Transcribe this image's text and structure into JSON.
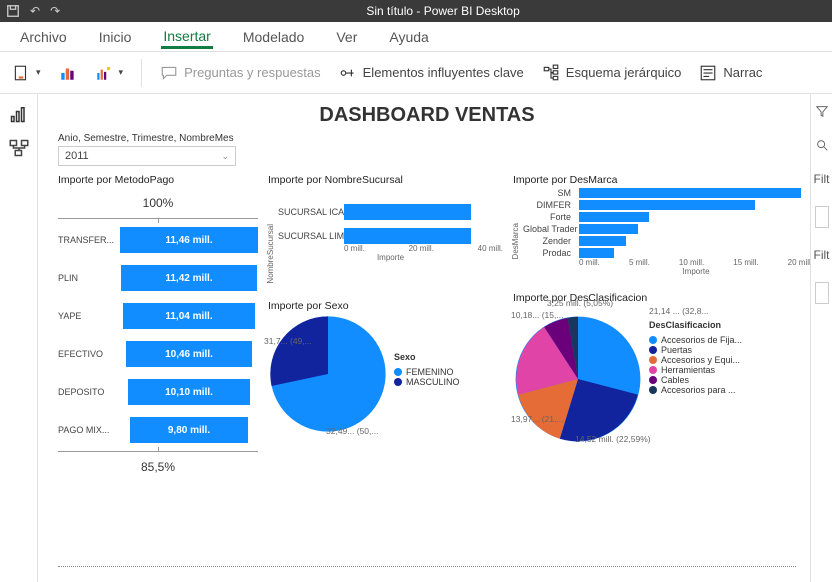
{
  "app": {
    "title": "Sin título - Power BI Desktop"
  },
  "menubar": {
    "archivo": "Archivo",
    "inicio": "Inicio",
    "insertar": "Insertar",
    "modelado": "Modelado",
    "ver": "Ver",
    "ayuda": "Ayuda"
  },
  "ribbon": {
    "preguntas": "Preguntas y respuestas",
    "influyentes": "Elementos influyentes clave",
    "esquema": "Esquema jerárquico",
    "narrac": "Narrac"
  },
  "rightrail": {
    "filt1": "Filt",
    "filt2": "Filt"
  },
  "dashboard": {
    "title": "DASHBOARD VENTAS"
  },
  "slicer": {
    "label": "Anio, Semestre, Trimestre, NombreMes",
    "value": "2011"
  },
  "funnel": {
    "title": "Importe por MetodoPago",
    "top": "100%",
    "rows": [
      {
        "cat": "TRANSFER...",
        "val": "11,46 mill.",
        "pct": 100
      },
      {
        "cat": "PLIN",
        "val": "11,42 mill.",
        "pct": 99
      },
      {
        "cat": "YAPE",
        "val": "11,04 mill.",
        "pct": 96
      },
      {
        "cat": "EFECTIVO",
        "val": "10,46 mill.",
        "pct": 91
      },
      {
        "cat": "DEPOSITO",
        "val": "10,10 mill.",
        "pct": 88
      },
      {
        "cat": "PAGO MIX...",
        "val": "9,80 mill.",
        "pct": 86
      }
    ],
    "bottom": "85,5%"
  },
  "sucursal": {
    "title": "Importe por NombreSucursal",
    "ylabel": "NombreSucursal",
    "xlabel": "Importe",
    "ticks": [
      "0 mill.",
      "20 mill.",
      "40 mill."
    ],
    "rows": [
      {
        "cat": "SUCURSAL ICA",
        "val": 32
      },
      {
        "cat": "SUCURSAL LIMA",
        "val": 32
      }
    ]
  },
  "marca": {
    "title": "Importe por DesMarca",
    "ylabel": "DesMarca",
    "xlabel": "Importe",
    "ticks": [
      "0 mill.",
      "5 mill.",
      "10 mill.",
      "15 mill.",
      "20 mill."
    ],
    "rows": [
      {
        "cat": "SM",
        "val": 19
      },
      {
        "cat": "DIMFER",
        "val": 15
      },
      {
        "cat": "Forte",
        "val": 6
      },
      {
        "cat": "Global Trader",
        "val": 5
      },
      {
        "cat": "Zender",
        "val": 4
      },
      {
        "cat": "Prodac",
        "val": 3
      }
    ]
  },
  "sexo": {
    "title": "Importe por Sexo",
    "legend_title": "Sexo",
    "labels_around": {
      "left": "31,7... (49,...",
      "bottom": "32,49... (50,..."
    },
    "legend": [
      {
        "name": "FEMENINO",
        "color": "#118dff"
      },
      {
        "name": "MASCULINO",
        "color": "#12239e"
      }
    ]
  },
  "clasif": {
    "title": "Importe por DesClasificacion",
    "legend_title": "DesClasificacion",
    "labels_around": {
      "top1": "3,25 mill. (5,05%)",
      "top2": "10,18... (15,...",
      "right": "21,14 ... (32,8...",
      "bottom": "14,52 mill. (22,59%)",
      "left": "13,97... (21,..."
    },
    "legend": [
      {
        "name": "Accesorios de Fija...",
        "color": "#118dff"
      },
      {
        "name": "Puertas",
        "color": "#12239e"
      },
      {
        "name": "Accesorios y Equi...",
        "color": "#e66c37"
      },
      {
        "name": "Herramientas",
        "color": "#e044a7"
      },
      {
        "name": "Cables",
        "color": "#6b007b"
      },
      {
        "name": "Accesorios para ...",
        "color": "#1a365d"
      }
    ]
  },
  "chart_data": [
    {
      "type": "bar",
      "orientation": "funnel",
      "title": "Importe por MetodoPago",
      "categories": [
        "TRANSFERENCIA",
        "PLIN",
        "YAPE",
        "EFECTIVO",
        "DEPOSITO",
        "PAGO MIXTO"
      ],
      "values": [
        11.46,
        11.42,
        11.04,
        10.46,
        10.1,
        9.8
      ],
      "unit": "mill.",
      "top_pct": 100,
      "bottom_pct": 85.5
    },
    {
      "type": "bar",
      "orientation": "horizontal",
      "title": "Importe por NombreSucursal",
      "categories": [
        "SUCURSAL ICA",
        "SUCURSAL LIMA"
      ],
      "values": [
        32,
        32
      ],
      "xlabel": "Importe",
      "ylabel": "NombreSucursal",
      "xlim": [
        0,
        40
      ],
      "unit": "mill."
    },
    {
      "type": "bar",
      "orientation": "horizontal",
      "title": "Importe por DesMarca",
      "categories": [
        "SM",
        "DIMFER",
        "Forte",
        "Global Trader",
        "Zender",
        "Prodac"
      ],
      "values": [
        19,
        15,
        6,
        5,
        4,
        3
      ],
      "xlabel": "Importe",
      "ylabel": "DesMarca",
      "xlim": [
        0,
        20
      ],
      "unit": "mill."
    },
    {
      "type": "pie",
      "title": "Importe por Sexo",
      "series": [
        {
          "name": "FEMENINO",
          "value": 32.49,
          "pct": 50
        },
        {
          "name": "MASCULINO",
          "value": 31.7,
          "pct": 49
        }
      ],
      "unit": "mill."
    },
    {
      "type": "pie",
      "title": "Importe por DesClasificacion",
      "series": [
        {
          "name": "Accesorios de Fijación",
          "value": 21.14,
          "pct": 32.8
        },
        {
          "name": "Puertas",
          "value": 14.52,
          "pct": 22.59
        },
        {
          "name": "Accesorios y Equipos",
          "value": 13.97,
          "pct": 21
        },
        {
          "name": "Herramientas",
          "value": 10.18,
          "pct": 15
        },
        {
          "name": "Cables",
          "value": 3.25,
          "pct": 5.05
        },
        {
          "name": "Accesorios para ...",
          "value": 1.2,
          "pct": 2
        }
      ],
      "unit": "mill."
    }
  ]
}
